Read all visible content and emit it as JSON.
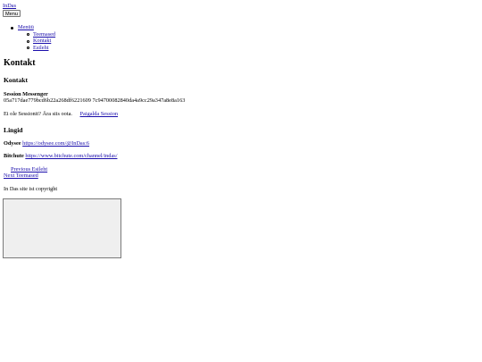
{
  "header": {
    "logo_alt": "InDas",
    "menu_button": "Menu"
  },
  "nav": {
    "top_label": "Menüü",
    "sub_items": [
      {
        "label": "Teemased"
      },
      {
        "label": "Kontakt"
      },
      {
        "label": "Esileht"
      }
    ]
  },
  "page": {
    "title": "Kontakt",
    "contact_heading": "Kontakt",
    "session_label": "Session Messenger",
    "session_id": "05a717dae779bcd6b22a268df6221609 7c94700082840da4a9cc29a347a8e8a163",
    "no_session_text": "Ei ole Sessionit? Ära siis oota.",
    "download_link": "Paigalda Session",
    "links_heading": "Lingid",
    "odysee_label": "Odysee",
    "odysee_url": "https://odysee.com/@InDas:6",
    "bitchute_label": "Bitchute",
    "bitchute_url": "https://www.bitchute.com/channel/indas/"
  },
  "post_nav": {
    "previous": "Previous Esileht",
    "next": "Next Teemased"
  },
  "footer": {
    "copyright": "In Das site ist copyright"
  },
  "colors": {
    "link": "#1a0dab",
    "frame_bg": "#efefef",
    "frame_border": "#7a7a7a"
  }
}
